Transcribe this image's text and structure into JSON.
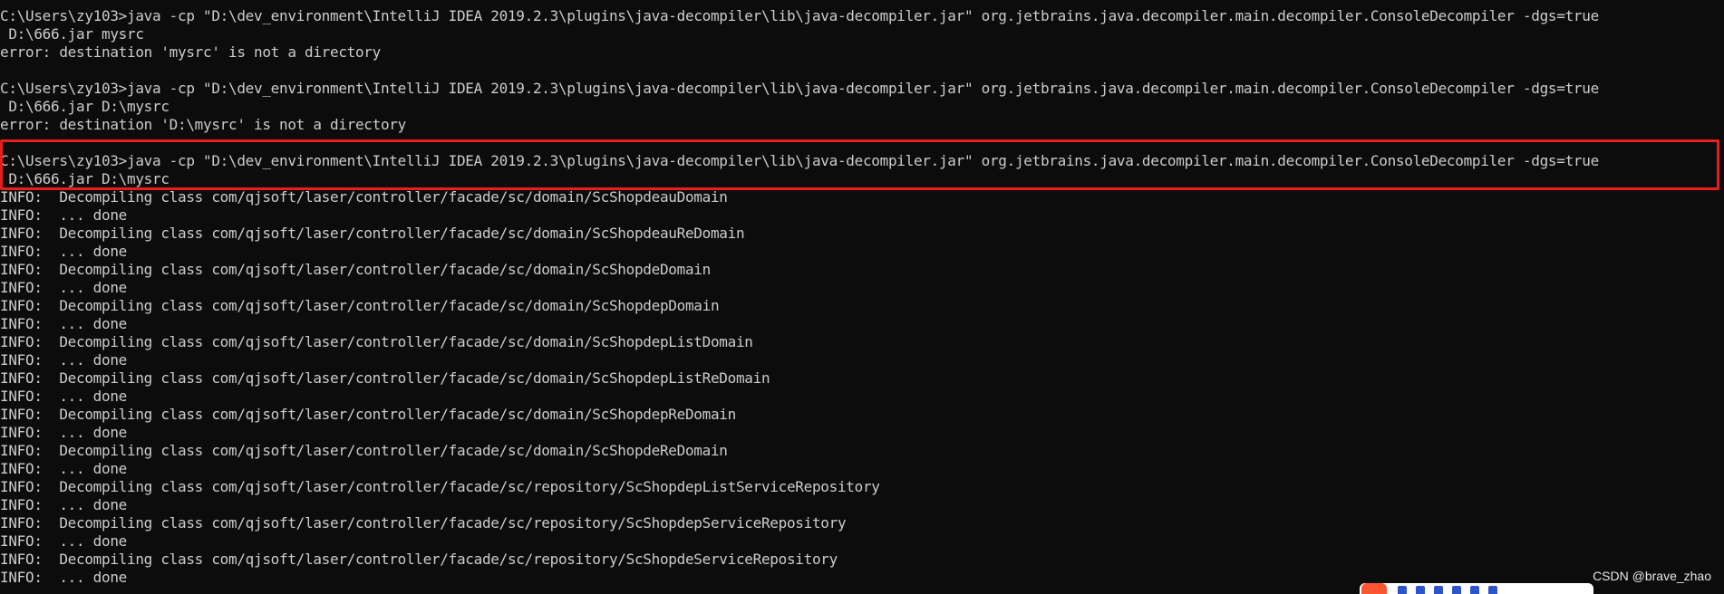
{
  "terminal": {
    "lines": [
      "C:\\Users\\zy103>java -cp \"D:\\dev_environment\\IntelliJ IDEA 2019.2.3\\plugins\\java-decompiler\\lib\\java-decompiler.jar\" org.jetbrains.java.decompiler.main.decompiler.ConsoleDecompiler -dgs=true",
      " D:\\666.jar mysrc",
      "error: destination 'mysrc' is not a directory",
      "",
      "C:\\Users\\zy103>java -cp \"D:\\dev_environment\\IntelliJ IDEA 2019.2.3\\plugins\\java-decompiler\\lib\\java-decompiler.jar\" org.jetbrains.java.decompiler.main.decompiler.ConsoleDecompiler -dgs=true",
      " D:\\666.jar D:\\mysrc",
      "error: destination 'D:\\mysrc' is not a directory",
      "",
      "C:\\Users\\zy103>java -cp \"D:\\dev_environment\\IntelliJ IDEA 2019.2.3\\plugins\\java-decompiler\\lib\\java-decompiler.jar\" org.jetbrains.java.decompiler.main.decompiler.ConsoleDecompiler -dgs=true",
      " D:\\666.jar D:\\mysrc",
      "INFO:  Decompiling class com/qjsoft/laser/controller/facade/sc/domain/ScShopdeauDomain",
      "INFO:  ... done",
      "INFO:  Decompiling class com/qjsoft/laser/controller/facade/sc/domain/ScShopdeauReDomain",
      "INFO:  ... done",
      "INFO:  Decompiling class com/qjsoft/laser/controller/facade/sc/domain/ScShopdeDomain",
      "INFO:  ... done",
      "INFO:  Decompiling class com/qjsoft/laser/controller/facade/sc/domain/ScShopdepDomain",
      "INFO:  ... done",
      "INFO:  Decompiling class com/qjsoft/laser/controller/facade/sc/domain/ScShopdepListDomain",
      "INFO:  ... done",
      "INFO:  Decompiling class com/qjsoft/laser/controller/facade/sc/domain/ScShopdepListReDomain",
      "INFO:  ... done",
      "INFO:  Decompiling class com/qjsoft/laser/controller/facade/sc/domain/ScShopdepReDomain",
      "INFO:  ... done",
      "INFO:  Decompiling class com/qjsoft/laser/controller/facade/sc/domain/ScShopdeReDomain",
      "INFO:  ... done",
      "INFO:  Decompiling class com/qjsoft/laser/controller/facade/sc/repository/ScShopdepListServiceRepository",
      "INFO:  ... done",
      "INFO:  Decompiling class com/qjsoft/laser/controller/facade/sc/repository/ScShopdepServiceRepository",
      "INFO:  ... done",
      "INFO:  Decompiling class com/qjsoft/laser/controller/facade/sc/repository/ScShopdeServiceRepository",
      "INFO:  ... done"
    ],
    "background_color": "#0c0c0c",
    "text_color": "#cccccc",
    "highlight_color": "#e81e1e"
  },
  "watermark": {
    "text": "CSDN @brave_zhao"
  }
}
